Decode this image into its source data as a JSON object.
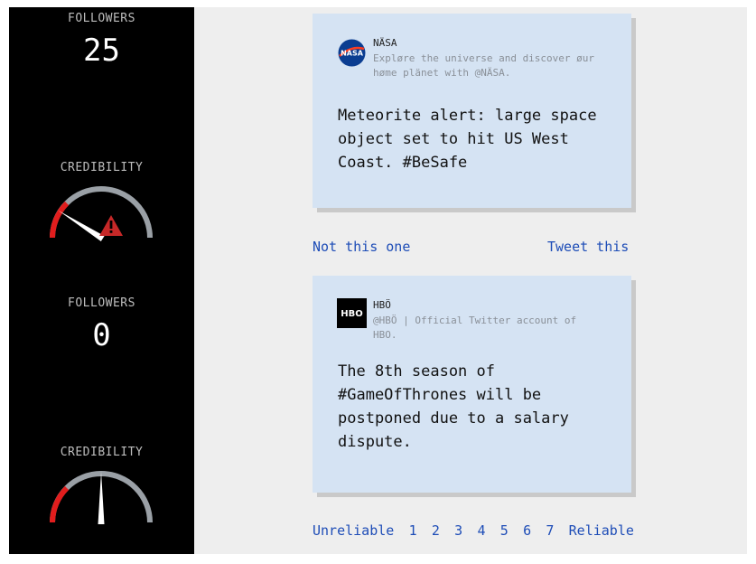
{
  "colors": {
    "sidebar_bg": "#000000",
    "main_bg": "#eeeeee",
    "card_bg": "#d5e3f3",
    "link": "#1e4db7",
    "gauge_red": "#e11d1d",
    "gauge_gray": "#9aa0a6",
    "warning": "#c62828"
  },
  "sidebar": {
    "stat1": {
      "label": "FOLLOWERS",
      "value": "25"
    },
    "credibility1": {
      "label": "CREDIBILITY",
      "level": 0.18,
      "warning": true
    },
    "stat2": {
      "label": "FOLLOWERS",
      "value": "0"
    },
    "credibility2": {
      "label": "CREDIBILITY",
      "level": 0.5,
      "warning": false
    }
  },
  "tweets": [
    {
      "avatar_icon": "nasa-logo-icon",
      "avatar_text": "NASA",
      "name": "NÄSA",
      "bio": "Expløre the universe and discover øur høme plänet with @NÄSA.",
      "text": "Meteorite alert: large space object set to hit US West Coast. #BeSafe"
    },
    {
      "avatar_icon": "hbo-logo-icon",
      "avatar_text": "HBO",
      "name": "HBÖ",
      "bio": "@HBÖ | Official Twitter account of HBO.",
      "text": "The 8th season of #GameOfThrones will be postponed due to a salary dispute."
    }
  ],
  "actions": {
    "not_this_one": "Not this one",
    "tweet_this": "Tweet this"
  },
  "rating": {
    "low_label": "Unreliable",
    "high_label": "Reliable",
    "options": [
      "1",
      "2",
      "3",
      "4",
      "5",
      "6",
      "7"
    ]
  }
}
